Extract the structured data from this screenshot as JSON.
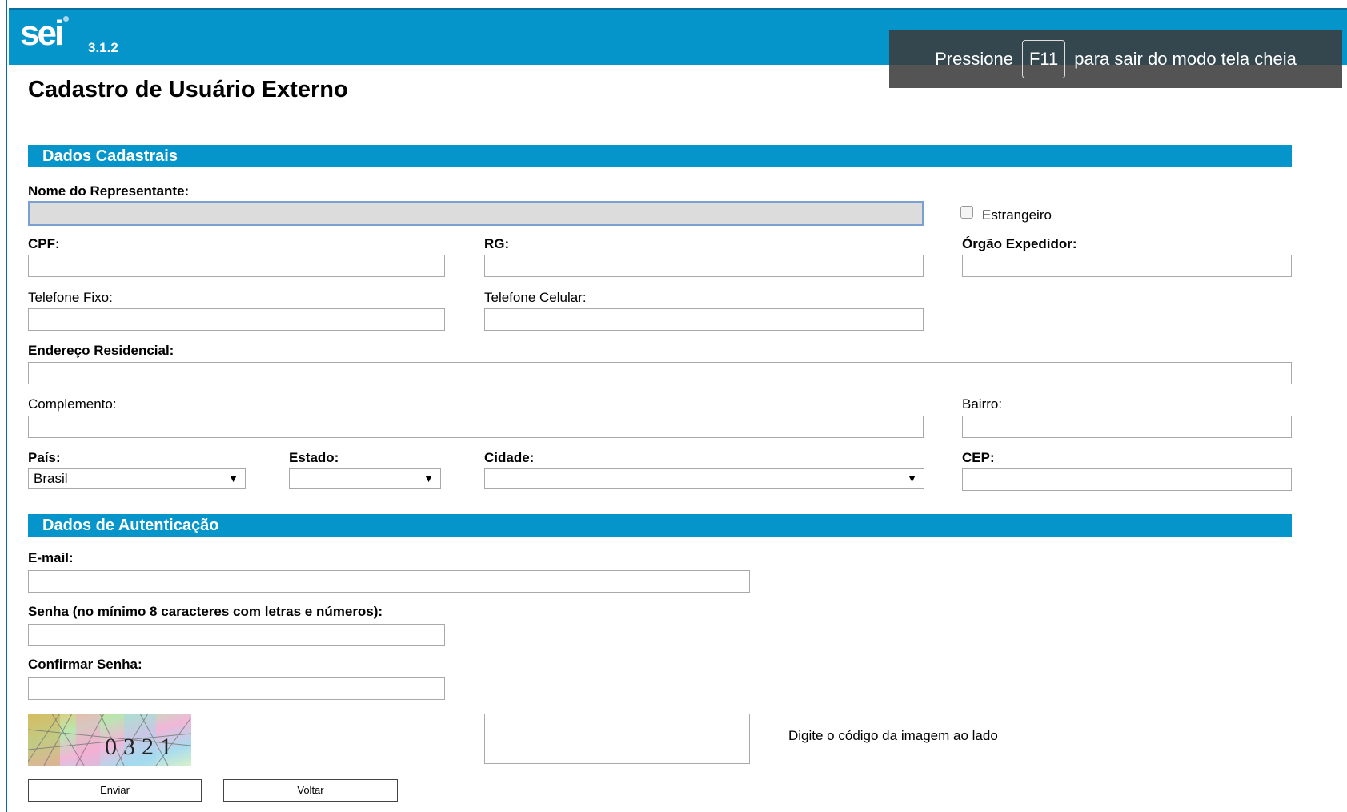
{
  "app": {
    "logo_text": "sei",
    "version": "3.1.2"
  },
  "fullscreen_notice": {
    "before": "Pressione",
    "key": "F11",
    "after": "para sair do modo tela cheia"
  },
  "page": {
    "title": "Cadastro de Usuário Externo"
  },
  "sections": {
    "cadastrais": "Dados Cadastrais",
    "autenticacao": "Dados de Autenticação"
  },
  "form": {
    "nome_label": "Nome do Representante:",
    "nome_value": "",
    "estrangeiro_label": "Estrangeiro",
    "cpf_label": "CPF:",
    "rg_label": "RG:",
    "orgao_label": "Órgão Expedidor:",
    "tel_fixo_label": "Telefone Fixo:",
    "tel_celular_label": "Telefone Celular:",
    "endereco_label": "Endereço Residencial:",
    "complemento_label": "Complemento:",
    "bairro_label": "Bairro:",
    "pais_label": "País:",
    "pais_value": "Brasil",
    "estado_label": "Estado:",
    "estado_value": "",
    "cidade_label": "Cidade:",
    "cidade_value": "",
    "cep_label": "CEP:",
    "email_label": "E-mail:",
    "senha_label": "Senha (no mínimo 8 caracteres com letras e números):",
    "confirmar_label": "Confirmar Senha:",
    "captcha_code": "0321",
    "captcha_hint": "Digite o código da imagem ao lado",
    "enviar_label": "Enviar",
    "voltar_label": "Voltar"
  },
  "colors": {
    "brand": "#0595cb",
    "frame": "#0a6e9e"
  }
}
